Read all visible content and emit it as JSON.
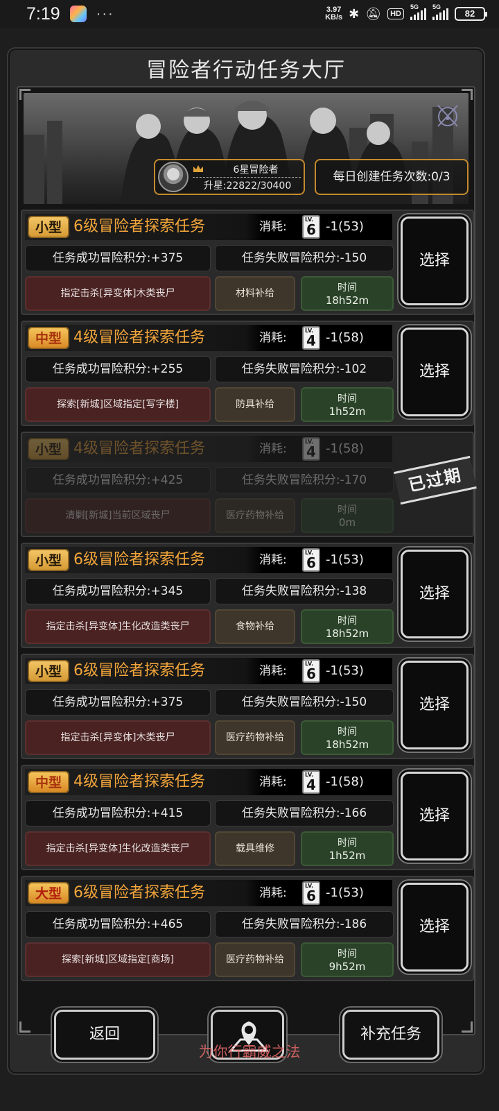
{
  "status_bar": {
    "time": "7:19",
    "speed_value": "3.97",
    "speed_unit": "KB/s",
    "hd_label": "HD",
    "signal1_label": "5G",
    "signal2_label": "5G",
    "battery": "82"
  },
  "page": {
    "title": "冒险者行动任务大厅"
  },
  "banner": {
    "rank_name": "6星冒险者",
    "rank_progress": "升星:22822/30400",
    "daily_create": "每日创建任务次数:0/3"
  },
  "tasks": [
    {
      "type": "小型",
      "name": "6级冒险者探索任务",
      "cost_label": "消耗:",
      "card_level": "6",
      "cost_value": "-1(53)",
      "success": "任务成功冒险积分:+375",
      "fail": "任务失败冒险积分:-150",
      "target": "指定击杀[异变体]木类丧尸",
      "reward": "材料补给",
      "time_label": "时间",
      "time_value": "18h52m",
      "action": "选择"
    },
    {
      "type": "中型",
      "name": "4级冒险者探索任务",
      "cost_label": "消耗:",
      "card_level": "4",
      "cost_value": "-1(58)",
      "success": "任务成功冒险积分:+255",
      "fail": "任务失败冒险积分:-102",
      "target": "探索[新城]区域指定[写字楼]",
      "reward": "防具补给",
      "time_label": "时间",
      "time_value": "1h52m",
      "action": "选择"
    },
    {
      "type": "小型",
      "name": "4级冒险者探索任务",
      "cost_label": "消耗:",
      "card_level": "4",
      "cost_value": "-1(58)",
      "success": "任务成功冒险积分:+425",
      "fail": "任务失败冒险积分:-170",
      "target": "清剿[新城]当前区域丧尸",
      "reward": "医疗药物补给",
      "time_label": "时间",
      "time_value": "0m",
      "status": "已过期"
    },
    {
      "type": "小型",
      "name": "6级冒险者探索任务",
      "cost_label": "消耗:",
      "card_level": "6",
      "cost_value": "-1(53)",
      "success": "任务成功冒险积分:+345",
      "fail": "任务失败冒险积分:-138",
      "target": "指定击杀[异变体]生化改造类丧尸",
      "reward": "食物补给",
      "time_label": "时间",
      "time_value": "18h52m",
      "action": "选择"
    },
    {
      "type": "小型",
      "name": "6级冒险者探索任务",
      "cost_label": "消耗:",
      "card_level": "6",
      "cost_value": "-1(53)",
      "success": "任务成功冒险积分:+375",
      "fail": "任务失败冒险积分:-150",
      "target": "指定击杀[异变体]木类丧尸",
      "reward": "医疗药物补给",
      "time_label": "时间",
      "time_value": "18h52m",
      "action": "选择"
    },
    {
      "type": "中型",
      "name": "4级冒险者探索任务",
      "cost_label": "消耗:",
      "card_level": "4",
      "cost_value": "-1(58)",
      "success": "任务成功冒险积分:+415",
      "fail": "任务失败冒险积分:-166",
      "target": "指定击杀[异变体]生化改造类丧尸",
      "reward": "载具维修",
      "time_label": "时间",
      "time_value": "1h52m",
      "action": "选择"
    },
    {
      "type": "大型",
      "name": "6级冒险者探索任务",
      "cost_label": "消耗:",
      "card_level": "6",
      "cost_value": "-1(53)",
      "success": "任务成功冒险积分:+465",
      "fail": "任务失败冒险积分:-186",
      "target": "探索[新城]区域指定[商场]",
      "reward": "医疗药物补给",
      "time_label": "时间",
      "time_value": "9h52m",
      "action": "选择"
    }
  ],
  "bottom": {
    "back": "返回",
    "refill": "补充任务",
    "watermark": "为你行霸威之法"
  },
  "card_lv_prefix": "LV.",
  "colors": {
    "accent_orange": "#f1a43a",
    "type_badge_gold": "#e3ad4c",
    "target_red": "#4a2222",
    "reward_brown": "#3e362a",
    "time_green": "#2a4228"
  }
}
